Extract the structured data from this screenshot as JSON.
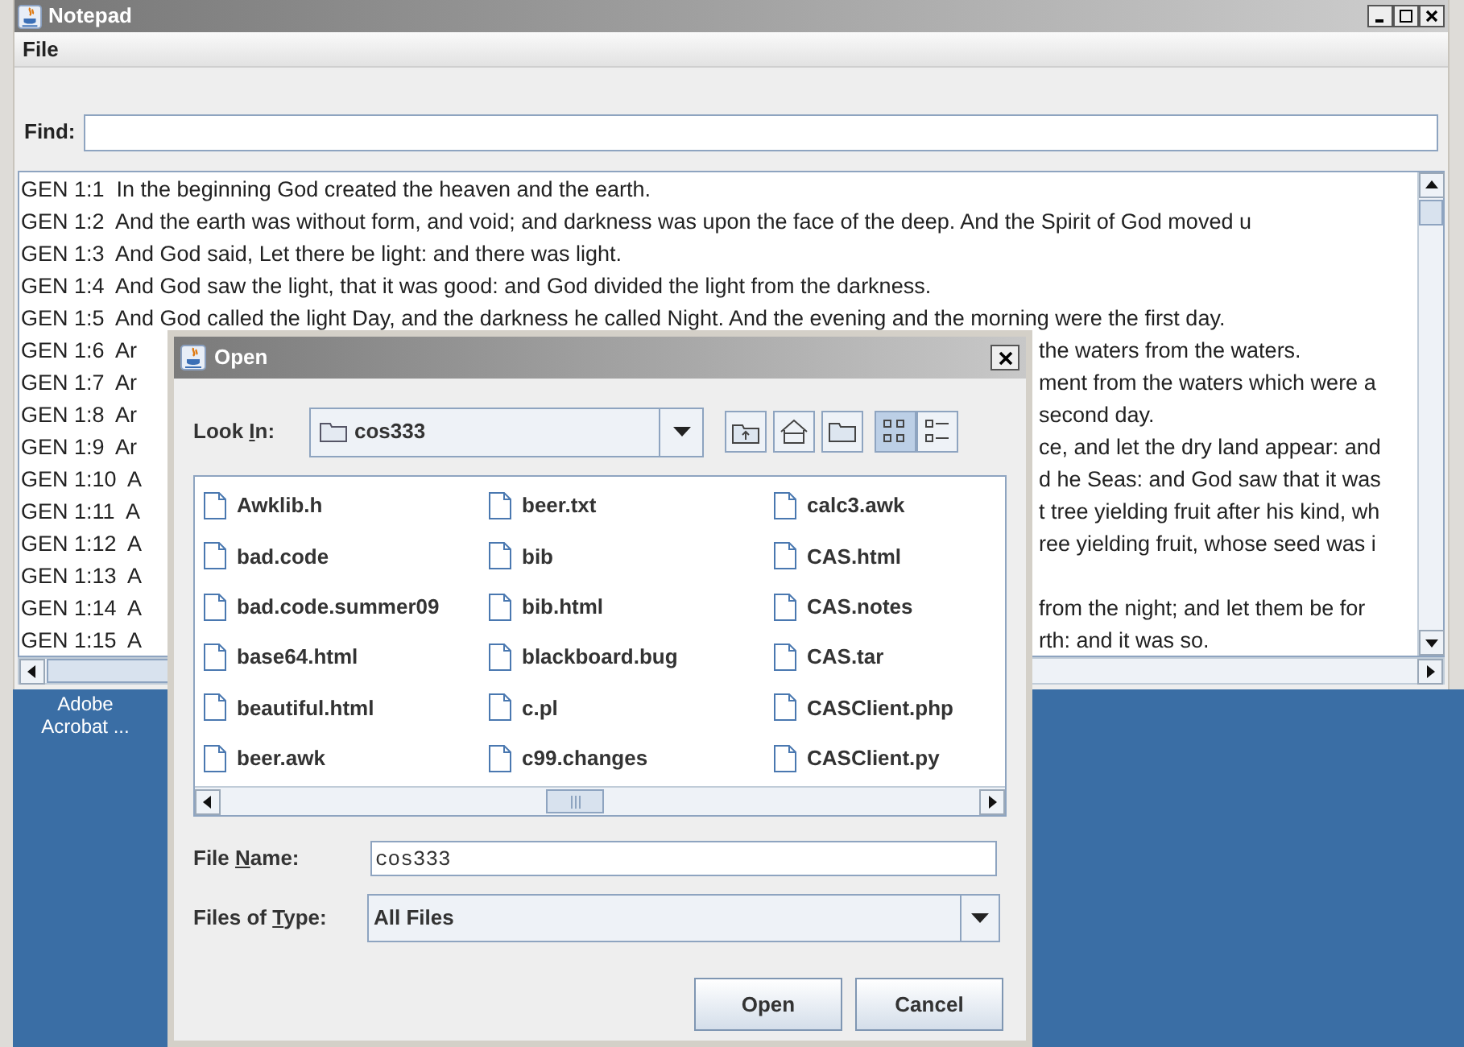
{
  "window": {
    "title": "Notepad"
  },
  "menu": [
    {
      "label": "File"
    }
  ],
  "find": {
    "label": "Find:"
  },
  "text_lines": [
    {
      "left": "GEN 1:1  In the beginning God created the heaven and the earth."
    },
    {
      "left": "GEN 1:2  And the earth was without form, and void; and darkness was upon the face of the deep. And the Spirit of God moved u"
    },
    {
      "left": "GEN 1:3  And God said, Let there be light: and there was light."
    },
    {
      "left": "GEN 1:4  And God saw the light, that it was good: and God divided the light from the darkness."
    },
    {
      "left": "GEN 1:5  And God called the light Day, and the darkness he called Night. And the evening and the morning were the first day."
    },
    {
      "left": "GEN 1:6  Ar",
      "right": "the waters from the waters."
    },
    {
      "left": "GEN 1:7  Ar",
      "right": "ment from the waters which were a"
    },
    {
      "left": "GEN 1:8  Ar",
      "right": "second day."
    },
    {
      "left": "GEN 1:9  Ar",
      "right": "ce, and let the dry land appear: and"
    },
    {
      "left": "GEN 1:10  A",
      "right": "d he Seas: and God saw that it was"
    },
    {
      "left": "GEN 1:11  A",
      "right": "t tree yielding fruit after his kind, wh"
    },
    {
      "left": "GEN 1:12  A",
      "right": "ree yielding fruit, whose seed was i"
    },
    {
      "left": "GEN 1:13  A"
    },
    {
      "left": "GEN 1:14  A",
      "right": "from the night; and let them be for"
    },
    {
      "left": "GEN 1:15  A",
      "right": "rth: and it was so."
    }
  ],
  "desktop": {
    "icon_label": "Adobe Acrobat ..."
  },
  "dialog": {
    "title": "Open",
    "look_in": {
      "label_before": "Look ",
      "label_key": "I",
      "label_after": "n:",
      "value": "cos333"
    },
    "view_buttons": [
      {
        "kind": "list",
        "selected": true
      },
      {
        "kind": "details",
        "selected": false
      }
    ],
    "files": [
      "Awklib.h",
      "bad.code",
      "bad.code.summer09",
      "base64.html",
      "beautiful.html",
      "beer.awk",
      "beer.txt",
      "bib",
      "bib.html",
      "blackboard.bug",
      "c.pl",
      "c99.changes",
      "calc3.awk",
      "CAS.html",
      "CAS.notes",
      "CAS.tar",
      "CASClient.php",
      "CASClient.py"
    ],
    "file_name": {
      "label_before": "File ",
      "label_key": "N",
      "label_after": "ame:",
      "value": "cos333"
    },
    "file_type": {
      "label_before": "Files of ",
      "label_key": "T",
      "label_after": "ype:",
      "value": "All Files"
    },
    "buttons": [
      "Open",
      "Cancel"
    ]
  }
}
